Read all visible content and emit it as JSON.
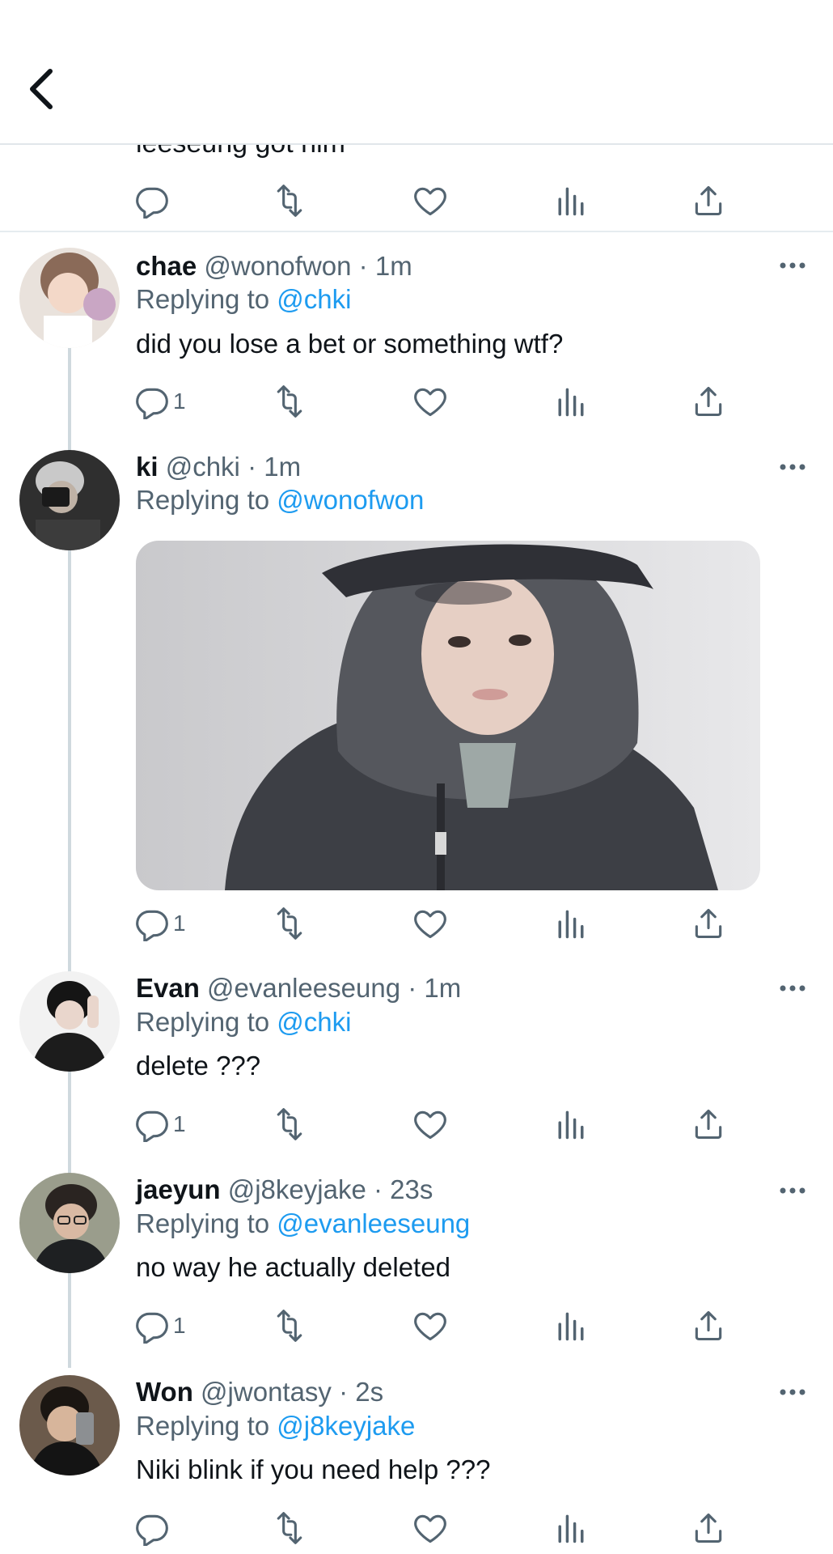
{
  "header": {
    "back_label": "<"
  },
  "partial_tweet_text": "leeseung got him",
  "replies": [
    {
      "name": "chae",
      "handle": "@wonofwon",
      "time": "1m",
      "replying_prefix": "Replying to",
      "replying_to": "@chki",
      "text": "did you lose a bet or something wtf?",
      "reply_count": "1"
    },
    {
      "name": "ki",
      "handle": "@chki",
      "time": "1m",
      "replying_prefix": "Replying to",
      "replying_to": "@wonofwon",
      "text": "",
      "reply_count": "1"
    },
    {
      "name": "Evan",
      "handle": "@evanleeseung",
      "time": "1m",
      "replying_prefix": "Replying to",
      "replying_to": "@chki",
      "text": "delete ???",
      "reply_count": "1"
    },
    {
      "name": "jaeyun",
      "handle": "@j8keyjake",
      "time": "23s",
      "replying_prefix": "Replying to",
      "replying_to": "@evanleeseung",
      "text": "no way he actually deleted",
      "reply_count": "1"
    },
    {
      "name": "Won",
      "handle": "@jwontasy",
      "time": "2s",
      "replying_prefix": "Replying to",
      "replying_to": "@j8keyjake",
      "text": "Niki blink if you need help ???",
      "reply_count": ""
    }
  ],
  "colors": {
    "accent": "#1d9bf0",
    "muted": "#536471",
    "text": "#0f1419",
    "icon": "#536471"
  },
  "icons": [
    "back-icon",
    "reply-icon",
    "retweet-icon",
    "like-icon",
    "views-icon",
    "share-icon",
    "more-icon"
  ]
}
